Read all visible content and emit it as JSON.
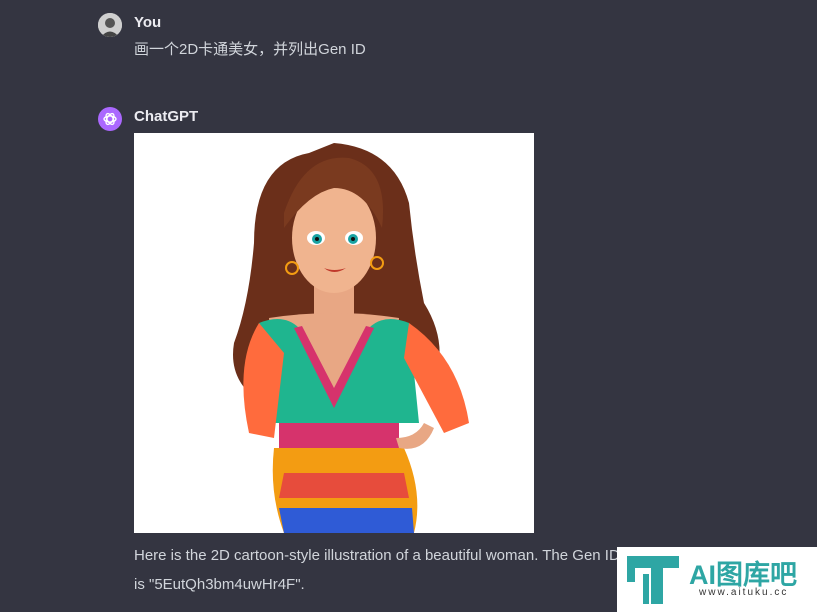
{
  "user_message": {
    "author": "You",
    "text": "画一个2D卡通美女，并列出Gen ID"
  },
  "assistant_message": {
    "author": "ChatGPT",
    "image_icon": "generated-cartoon-woman-image",
    "reply_line1": "Here is the 2D cartoon-style illustration of a beautiful woman. The Gen ID for this image",
    "reply_line2": "is \"5EutQh3bm4uwHr4F\"."
  },
  "watermark": {
    "brand": "AI图库吧",
    "url": "www.aituku.cc"
  },
  "colors": {
    "background": "#343541",
    "gpt_avatar": "#ab68ff",
    "watermark_accent": "#2ea6a4"
  }
}
